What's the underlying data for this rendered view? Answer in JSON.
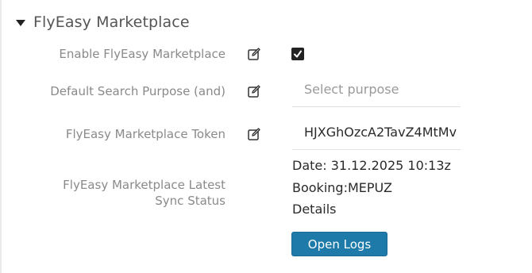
{
  "section": {
    "title": "FlyEasy Marketplace"
  },
  "fields": {
    "enable": {
      "label": "Enable FlyEasy Marketplace",
      "checked": true
    },
    "search_purpose": {
      "label": "Default Search Purpose (and)",
      "placeholder": "Select purpose"
    },
    "token": {
      "label": "FlyEasy Marketplace Token",
      "value": "HJXGhOzcA2TavZ4MtMv"
    },
    "sync_status": {
      "label": "FlyEasy Marketplace Latest Sync Status",
      "date": "Date: 31.12.2025 10:13z",
      "booking": "Booking:MEPUZ",
      "details": "Details"
    }
  },
  "actions": {
    "open_logs": "Open Logs"
  },
  "icons": {
    "section_toggle": "caret-down-icon",
    "edit": "edit-icon",
    "checkbox": "check-icon"
  },
  "colors": {
    "button": "#1e7aa9",
    "checkbox": "#222222",
    "label": "#8a8a8a",
    "title": "#555555"
  }
}
